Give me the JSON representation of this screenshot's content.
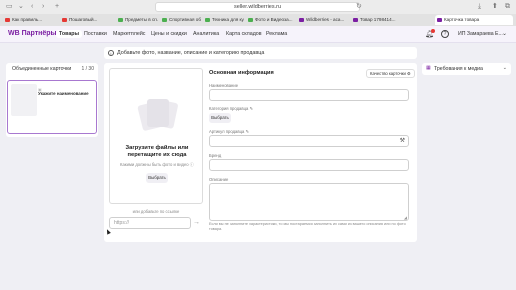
{
  "browser": {
    "url": "seller.wildberries.ru",
    "tabs": [
      {
        "label": "Как правиль...",
        "color": "#e53935"
      },
      {
        "label": "Пошаговый...",
        "color": "#e53935"
      },
      {
        "label": "Предметы в сп...",
        "color": "#4caf50"
      },
      {
        "label": "Спортивная обу...",
        "color": "#4caf50"
      },
      {
        "label": "Техника для ку...",
        "color": "#4caf50"
      },
      {
        "label": "Фото и Видеоза...",
        "color": "#4caf50"
      },
      {
        "label": "Wildberries - аса...",
        "color": "#7b1fa2"
      },
      {
        "label": "Товар 1798414...",
        "color": "#7b1fa2"
      },
      {
        "label": "Карточка товара",
        "color": "#7b1fa2"
      }
    ]
  },
  "nav": {
    "logo": "WB Партнёры",
    "items": [
      "Товары",
      "Поставки",
      "Маркетплейс",
      "Цены и скидки",
      "Аналитика",
      "Карта складов",
      "Реклама"
    ],
    "account": "ИП Замараева Е..."
  },
  "banner": {
    "text": "Добавьте фото, название, описание и категорию продавца"
  },
  "left_panel": {
    "title": "Объединенные карточки",
    "count": "1 / 30",
    "card_name": "Укажите наименование"
  },
  "upload": {
    "title": "Загрузите файлы или перетащите их сюда",
    "subtitle": "Какими должны быть фото и видео ⓘ",
    "button": "Выбрать",
    "or_link": "или добавьте по ссылке",
    "url_placeholder": "https://"
  },
  "form": {
    "section_title": "Основная информация",
    "quality_label": "Качество карточки",
    "name_label": "Наименование",
    "category_label": "Категория продавца",
    "category_button": "Выбрать",
    "article_label": "Артикул продавца",
    "brand_label": "Бренд",
    "description_label": "Описание",
    "note": "Если вы не заполните характеристики, то мы постараемся заполнить их сами из вашего описания или по фото товара."
  },
  "requirements": {
    "label": "Требования к медиа"
  }
}
